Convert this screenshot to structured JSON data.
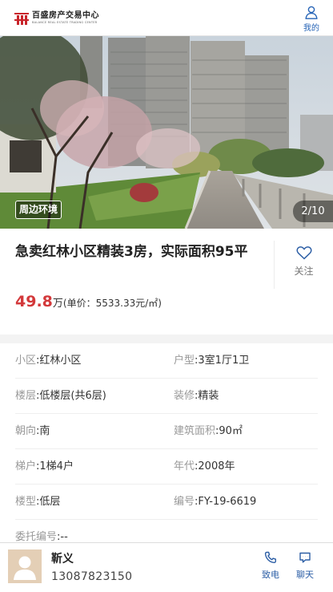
{
  "header": {
    "logo_cn": "百盛房产交易中心",
    "logo_en": "BALANCE REAL ESTATE TRADING CENTER",
    "user_label": "我的",
    "brand_color": "#c9252b",
    "user_icon": "user-icon"
  },
  "gallery": {
    "tag": "周边环境",
    "counter": "2/10",
    "current": 2,
    "total": 10
  },
  "listing": {
    "title": "急卖红林小区精装3房，实际面积95平",
    "follow_label": "关注",
    "price": "49.8",
    "price_unit": "万",
    "unit_price": "(单价：5533.33元/㎡)",
    "price_color": "#d3393b"
  },
  "info": {
    "rows": [
      [
        {
          "k": "小区",
          "v": ":红林小区"
        },
        {
          "k": "户型",
          "v": ":3室1厅1卫"
        }
      ],
      [
        {
          "k": "楼层",
          "v": ":低楼层(共6层)"
        },
        {
          "k": "装修",
          "v": ":精装"
        }
      ],
      [
        {
          "k": "朝向",
          "v": ":南"
        },
        {
          "k": "建筑面积",
          "v": ":90㎡"
        }
      ],
      [
        {
          "k": "梯户",
          "v": ":1梯4户"
        },
        {
          "k": "年代",
          "v": ":2008年"
        }
      ],
      [
        {
          "k": "楼型",
          "v": ":低层"
        },
        {
          "k": "编号",
          "v": ":FY-19-6619"
        }
      ],
      [
        {
          "k": "委托编号",
          "v": ":--"
        }
      ]
    ]
  },
  "agent": {
    "name": "靳义",
    "phone": "13087823150",
    "call_label": "致电",
    "chat_label": "聊天",
    "action_color": "#2d5fa6"
  }
}
